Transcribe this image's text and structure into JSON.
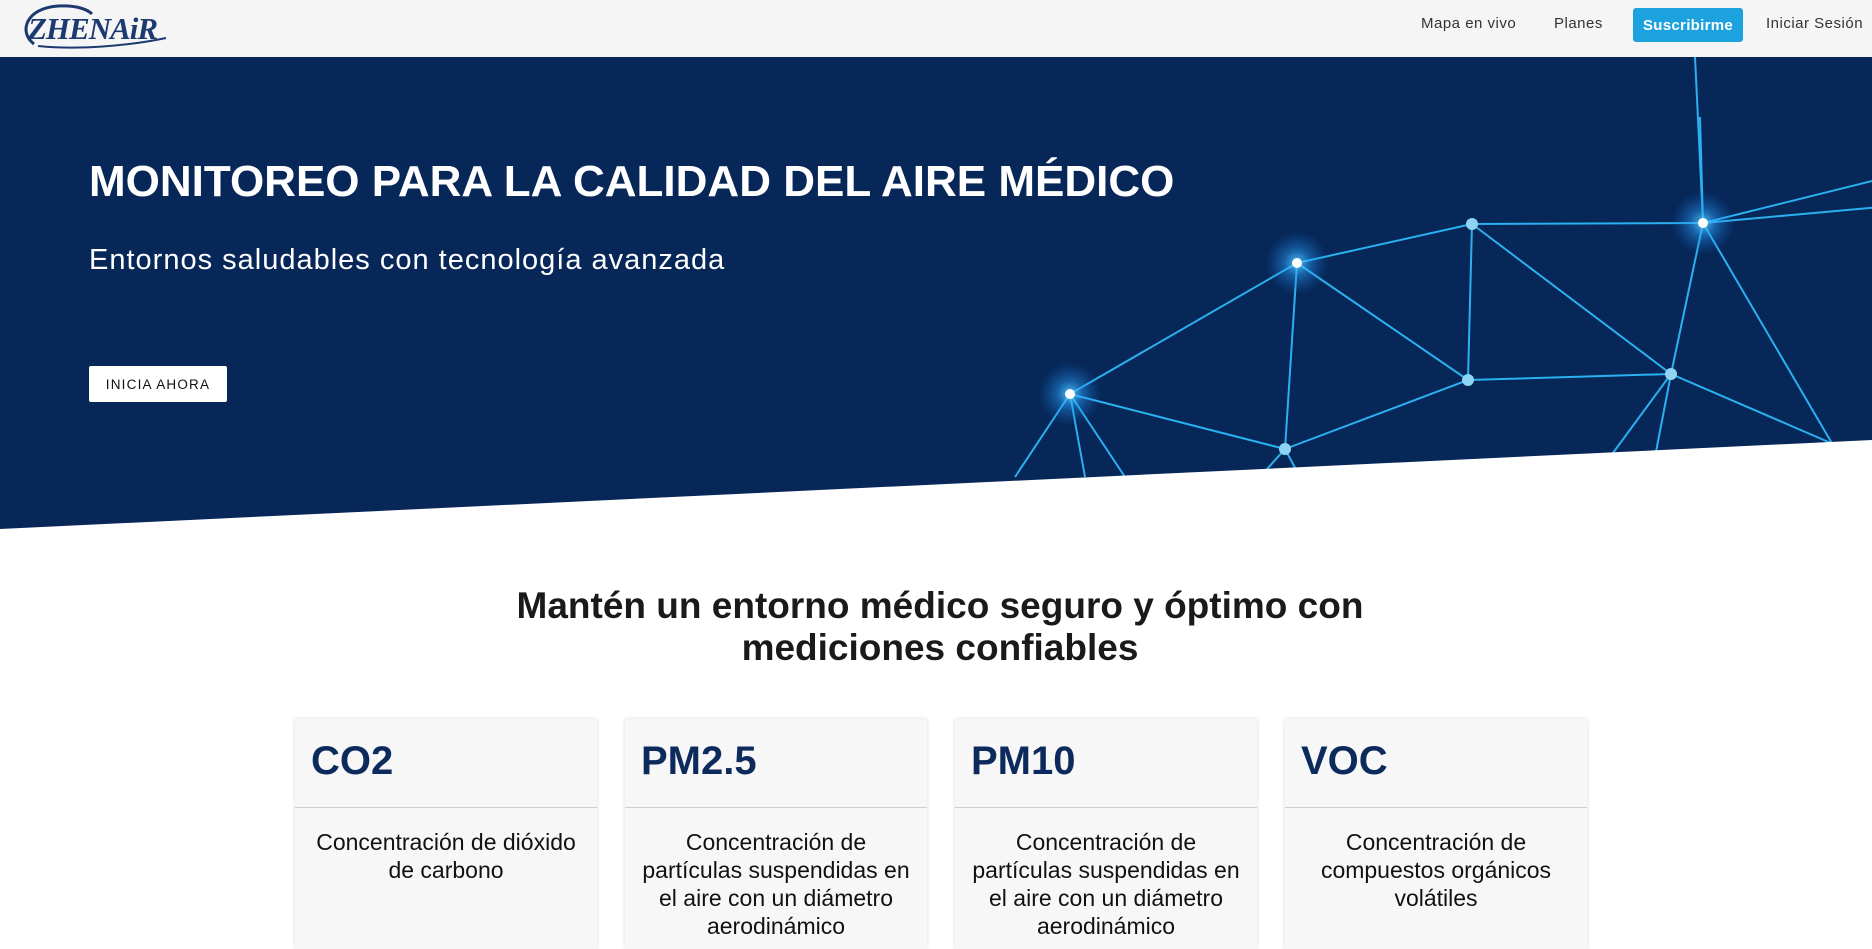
{
  "nav": {
    "logo": "ZHENAiR",
    "links": [
      "Mapa en vivo",
      "Planes"
    ],
    "cta": "Suscribirme",
    "login": "Iniciar Sesión"
  },
  "hero": {
    "title": "MONITOREO PARA LA CALIDAD DEL AIRE MÉDICO",
    "subtitle": "Entornos saludables con tecnología avanzada",
    "button": "INICIA AHORA"
  },
  "section": {
    "title_line1": "Mantén un entorno médico seguro y óptimo con",
    "title_line2": "mediciones confiables"
  },
  "cards": [
    {
      "title": "CO2",
      "description": "Concentración de dióxido de carbono"
    },
    {
      "title": "PM2.5",
      "description": "Concentración de partículas suspendidas en el aire con un diámetro aerodinámico"
    },
    {
      "title": "PM10",
      "description": "Concentración de partículas suspendidas en el aire con un diámetro aerodinámico"
    },
    {
      "title": "VOC",
      "description": "Concentración de compuestos orgánicos volátiles"
    }
  ],
  "colors": {
    "hero_bg": "#062758",
    "accent": "#1da2e0",
    "card_title": "#0c2a5c"
  }
}
